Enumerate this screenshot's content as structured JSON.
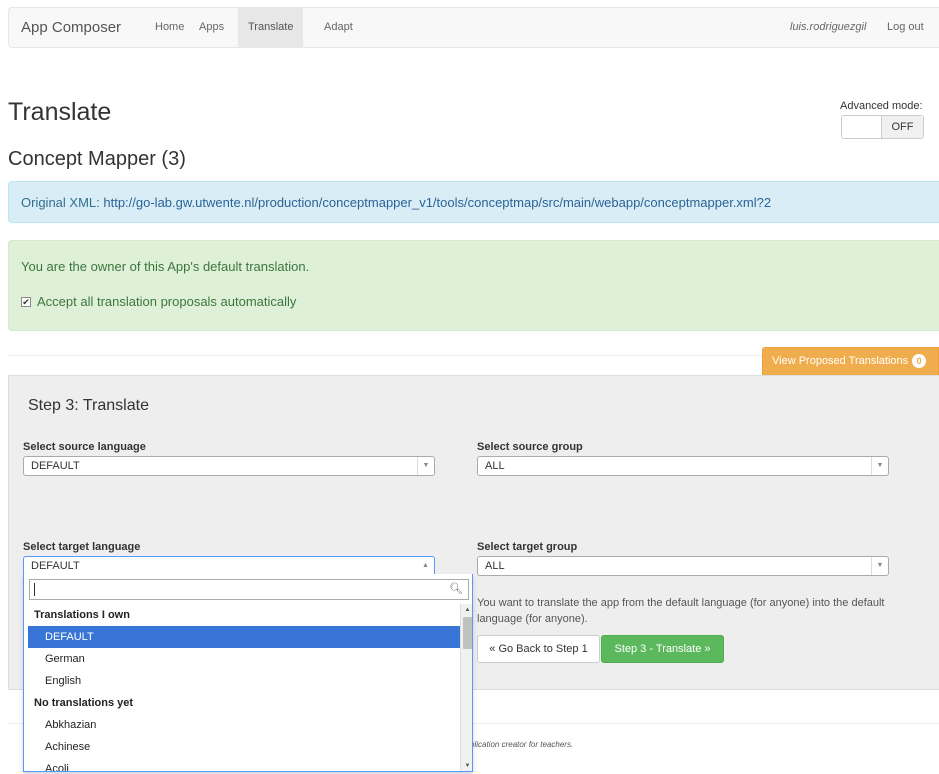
{
  "navbar": {
    "brand": "App Composer",
    "items": [
      {
        "label": "Home"
      },
      {
        "label": "Apps"
      },
      {
        "label": "Translate"
      },
      {
        "label": "Adapt"
      }
    ],
    "user": "luis.rodriguezgil",
    "logout": "Log out"
  },
  "page": {
    "title": "Translate",
    "subtitle": "Concept Mapper (3)",
    "advanced_mode_label": "Advanced mode:",
    "advanced_mode_value": "OFF"
  },
  "original_xml": {
    "label": "Original XML: ",
    "url": "http://go-lab.gw.utwente.nl/production/conceptmapper_v1/tools/conceptmap/src/main/webapp/conceptmapper.xml?2"
  },
  "ownership": {
    "message": "You are the owner of this App's default translation.",
    "checkbox_label": "Accept all translation proposals automatically",
    "checkbox_mark": "✔"
  },
  "proposed": {
    "label": "View Proposed Translations",
    "count": "0"
  },
  "step": {
    "title": "Step 3: Translate",
    "source_language_label": "Select source language",
    "source_language_value": "DEFAULT",
    "source_group_label": "Select source group",
    "source_group_value": "ALL",
    "target_language_label": "Select target language",
    "target_language_value": "DEFAULT",
    "target_group_label": "Select target group",
    "target_group_value": "ALL",
    "help": "You want to translate the app from the default language (for anyone) into the default language (for anyone).",
    "back_button": "« Go Back to Step 1",
    "translate_button": "Step 3 - Translate »"
  },
  "footer": {
    "text": "plication creator for teachers."
  },
  "dropdown": {
    "search_value": "",
    "group_own": "Translations I own",
    "own_options": [
      "DEFAULT",
      "German",
      "English"
    ],
    "group_none": "No translations yet",
    "none_options": [
      "Abkhazian",
      "Achinese",
      "Acoli"
    ]
  }
}
